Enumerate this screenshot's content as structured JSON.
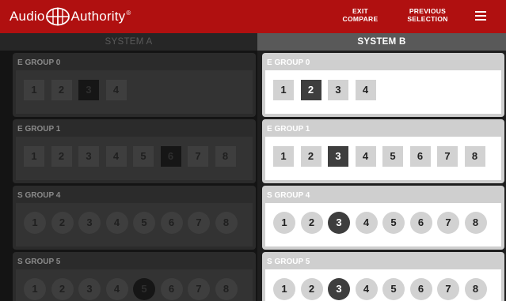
{
  "brand": {
    "name_left": "Audio",
    "name_right": "Authority",
    "reg": "®"
  },
  "top_buttons": {
    "exit_line1": "EXIT",
    "exit_line2": "COMPARE",
    "prev_line1": "PREVIOUS",
    "prev_line2": "SELECTION"
  },
  "tabs": {
    "system_a": "SYSTEM A",
    "system_b": "SYSTEM B",
    "active": "system_b"
  },
  "colors": {
    "header_red": "#b01010",
    "selected_dark": "#3e3e3e"
  },
  "system_a": {
    "groups": [
      {
        "title": "E GROUP 0",
        "shape": "square",
        "buttons": [
          "1",
          "2",
          "3",
          "4"
        ],
        "selected": "3"
      },
      {
        "title": "E GROUP 1",
        "shape": "square",
        "buttons": [
          "1",
          "2",
          "3",
          "4",
          "5",
          "6",
          "7",
          "8"
        ],
        "selected": "6"
      },
      {
        "title": "S GROUP 4",
        "shape": "round",
        "buttons": [
          "1",
          "2",
          "3",
          "4",
          "5",
          "6",
          "7",
          "8"
        ],
        "selected": ""
      },
      {
        "title": "S GROUP 5",
        "shape": "round",
        "buttons": [
          "1",
          "2",
          "3",
          "4",
          "5",
          "6",
          "7",
          "8"
        ],
        "selected": "5"
      }
    ]
  },
  "system_b": {
    "groups": [
      {
        "title": "E GROUP 0",
        "shape": "square",
        "buttons": [
          "1",
          "2",
          "3",
          "4"
        ],
        "selected": "2"
      },
      {
        "title": "E GROUP 1",
        "shape": "square",
        "buttons": [
          "1",
          "2",
          "3",
          "4",
          "5",
          "6",
          "7",
          "8"
        ],
        "selected": "3"
      },
      {
        "title": "S GROUP 4",
        "shape": "round",
        "buttons": [
          "1",
          "2",
          "3",
          "4",
          "5",
          "6",
          "7",
          "8"
        ],
        "selected": "3"
      },
      {
        "title": "S GROUP 5",
        "shape": "round",
        "buttons": [
          "1",
          "2",
          "3",
          "4",
          "5",
          "6",
          "7",
          "8"
        ],
        "selected": "3"
      }
    ]
  }
}
